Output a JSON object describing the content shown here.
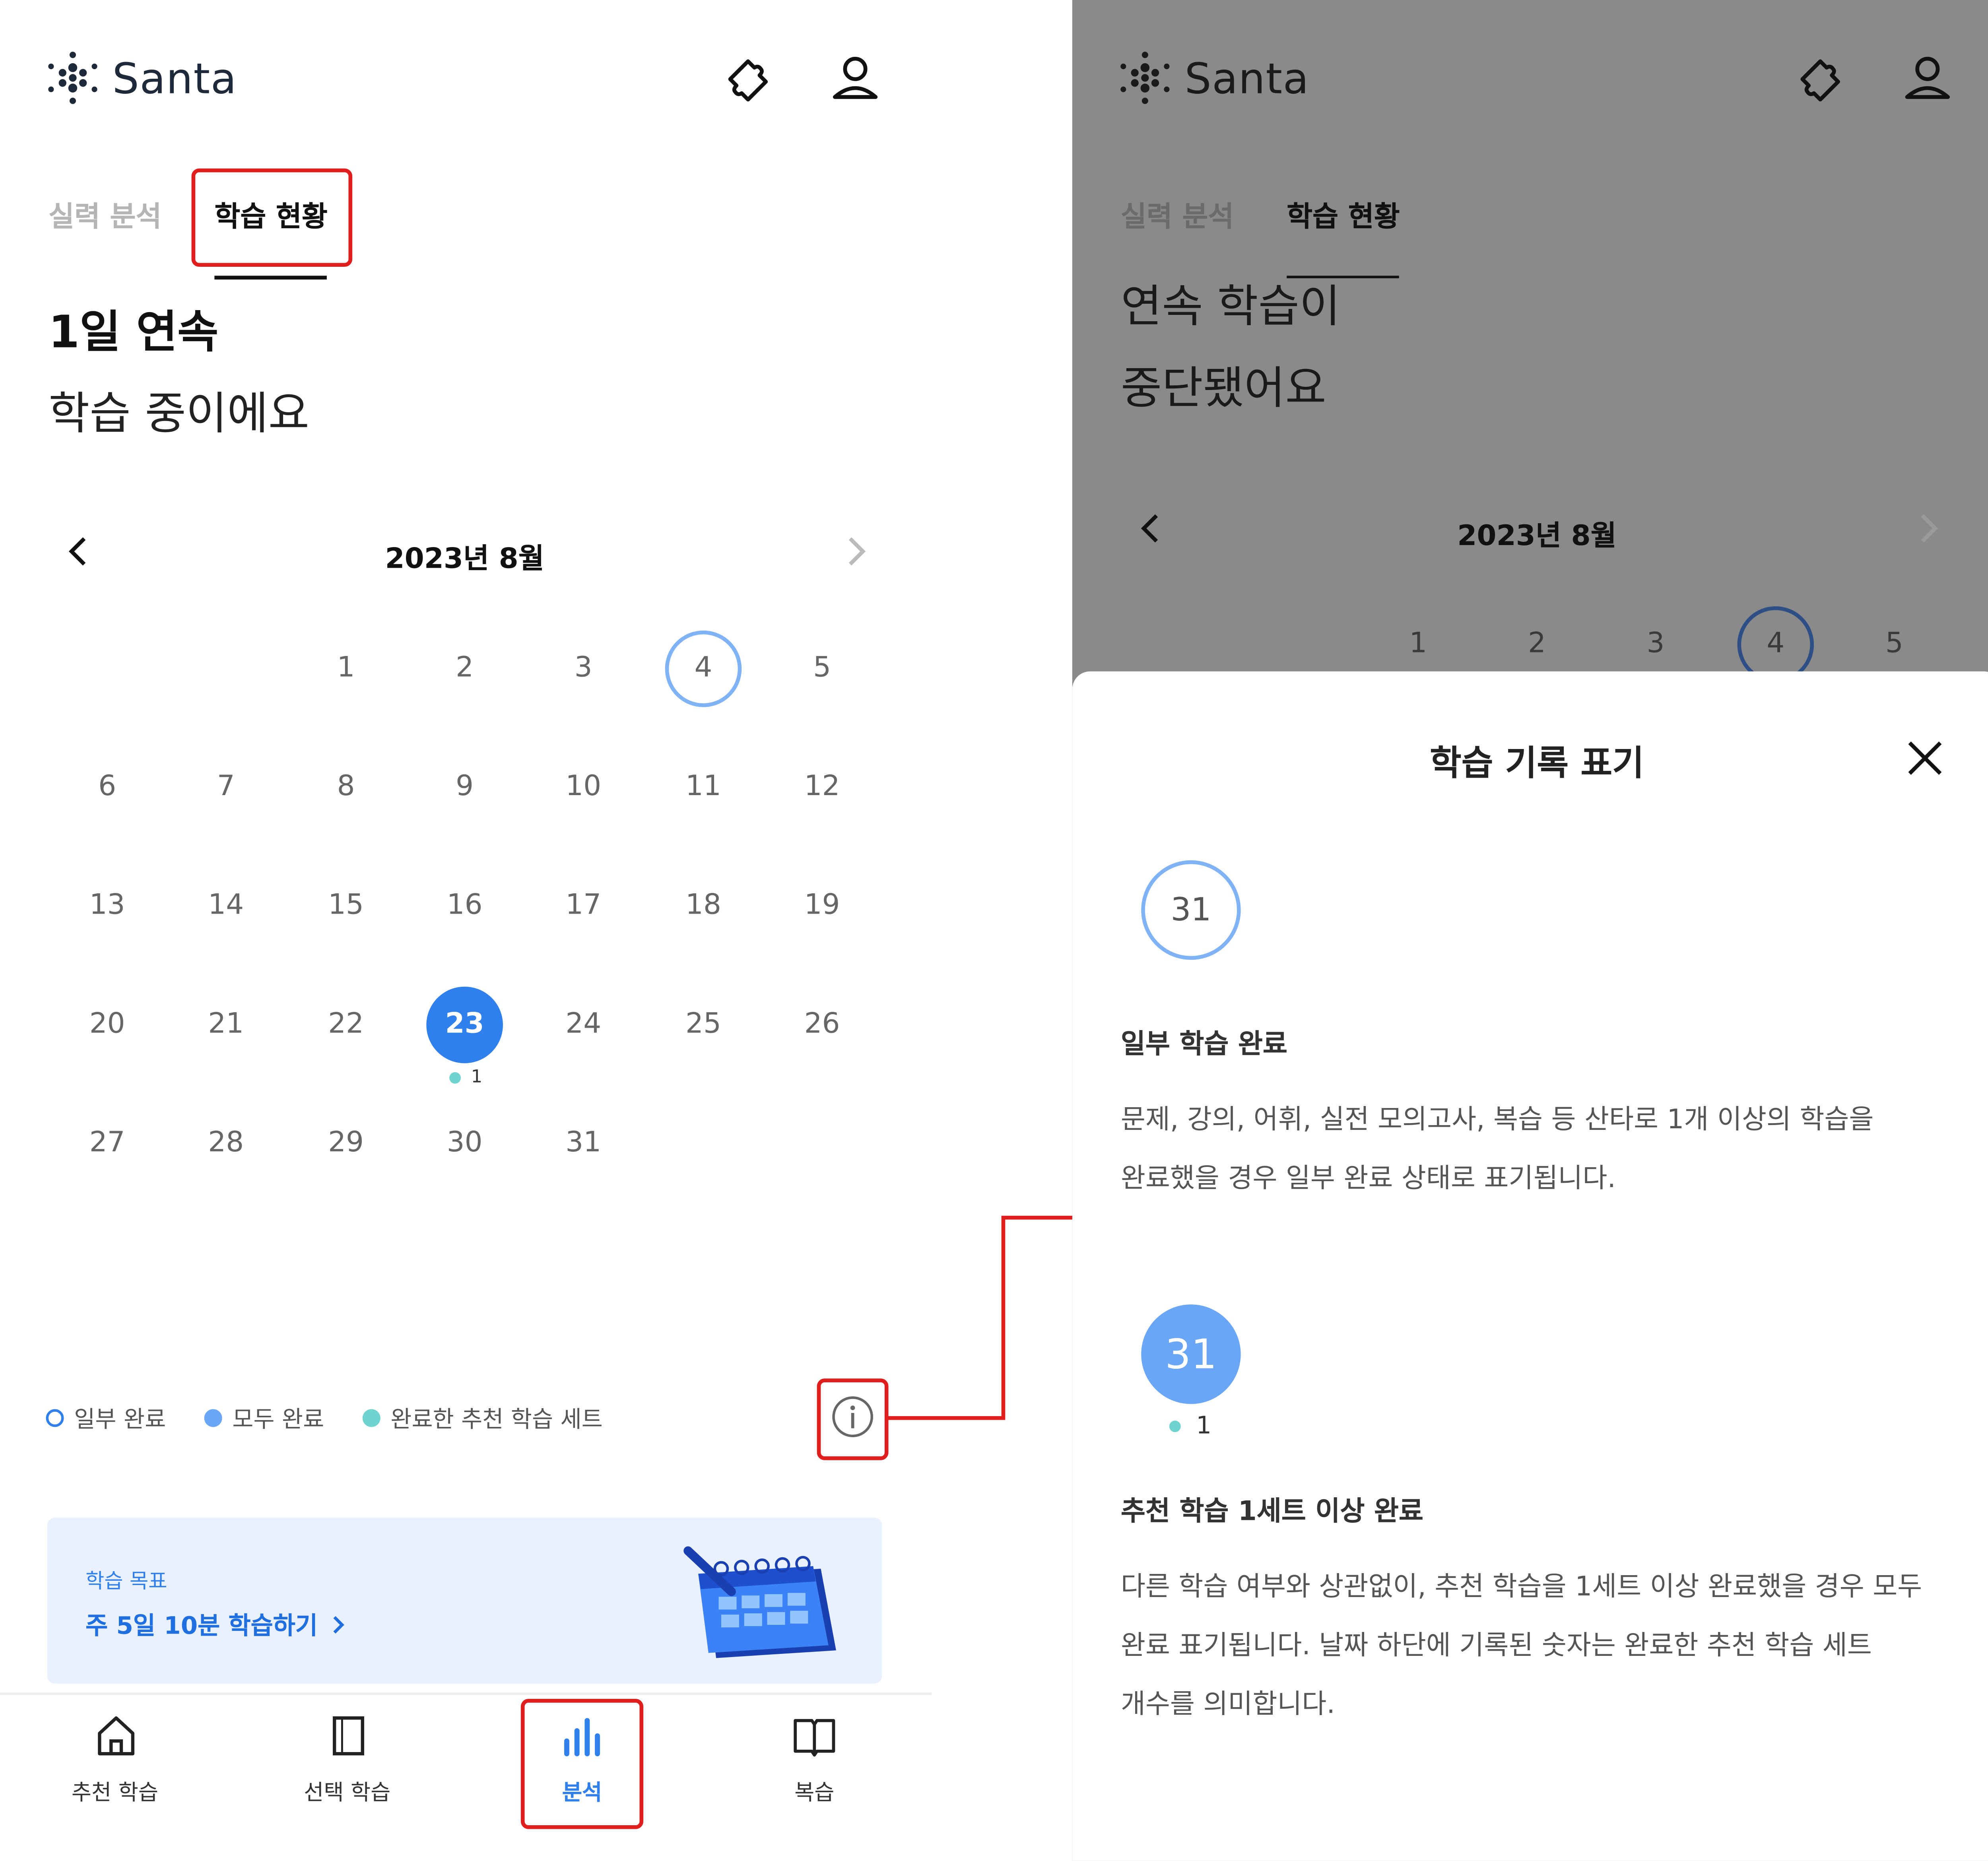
{
  "app": {
    "name": "Santa"
  },
  "header": {
    "ticket_icon": "ticket-icon",
    "profile_icon": "profile-icon"
  },
  "tabs": [
    {
      "label": "실력 분석",
      "active": false
    },
    {
      "label": "학습 현황",
      "active": true
    }
  ],
  "left": {
    "streak_title": "1일 연속",
    "streak_subtitle": "학습 중이에요",
    "calendar": {
      "month_label": "2023년 8월",
      "weeks": [
        [
          "",
          "",
          "1",
          "2",
          "3",
          "4",
          "5"
        ],
        [
          "6",
          "7",
          "8",
          "9",
          "10",
          "11",
          "12"
        ],
        [
          "13",
          "14",
          "15",
          "16",
          "17",
          "18",
          "19"
        ],
        [
          "20",
          "21",
          "22",
          "23",
          "24",
          "25",
          "26"
        ],
        [
          "27",
          "28",
          "29",
          "30",
          "31",
          "",
          ""
        ]
      ],
      "partial_day": "4",
      "full_day": "23",
      "full_day_sets": "1"
    },
    "legend": [
      {
        "label": "일부 완료",
        "style": "outline",
        "color": "#2f80ed"
      },
      {
        "label": "모두 완료",
        "style": "filled",
        "color": "#6aa6f8"
      },
      {
        "label": "완료한 추천 학습 세트",
        "style": "filled",
        "color": "#6fd3cf"
      }
    ],
    "info_icon": "info-icon",
    "goal": {
      "label": "학습 목표",
      "link_text": "주 5일 10분 학습하기"
    },
    "bottom_nav": [
      {
        "label": "추천 학습",
        "icon": "home-icon",
        "active": false
      },
      {
        "label": "선택 학습",
        "icon": "book-icon",
        "active": false
      },
      {
        "label": "분석",
        "icon": "chart-icon",
        "active": true
      },
      {
        "label": "복습",
        "icon": "open-book-icon",
        "active": false
      }
    ]
  },
  "right": {
    "streak_title_line1": "연속 학습이",
    "streak_title_line2": "중단됐어요",
    "month_label": "2023년 8월",
    "first_row_days": [
      "1",
      "2",
      "3",
      "4",
      "5"
    ],
    "sheet": {
      "title": "학습 기록 표기",
      "example_day": "31",
      "example_sets": "1",
      "partial_heading": "일부 학습 완료",
      "partial_desc_line1": "문제, 강의, 어휘, 실전 모의고사, 복습 등 산타로 1개 이상의 학습을",
      "partial_desc_line2": "완료했을 경우 일부 완료 상태로 표기됩니다.",
      "full_heading": "추천 학습 1세트 이상 완료",
      "full_desc_line1": "다른 학습 여부와 상관없이, 추천 학습을 1세트 이상 완료했을 경우 모두",
      "full_desc_line2": "완료 표기됩니다. 날짜 하단에 기록된 숫자는 완료한 추천 학습 세트",
      "full_desc_line3": "개수를 의미합니다."
    }
  },
  "colors": {
    "accent": "#2f80ed",
    "partial_ring": "#7fb3f5",
    "teal_dot": "#6fd3cf",
    "highlight": "#e01e1e",
    "goal_bg": "#e8f1fd"
  }
}
